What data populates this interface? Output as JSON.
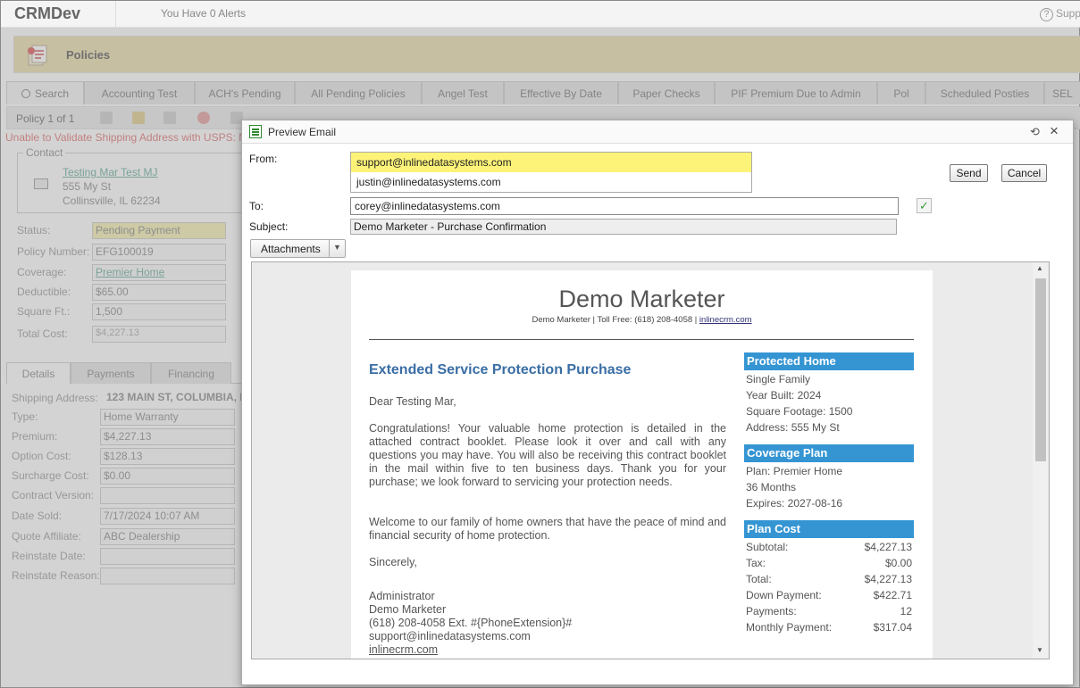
{
  "app": {
    "brand": "CRMDev",
    "alerts": "You Have 0 Alerts",
    "help": "Supp",
    "section_title": "Policies"
  },
  "tabs": [
    {
      "label": "Search"
    },
    {
      "label": "Accounting Test"
    },
    {
      "label": "ACH's Pending"
    },
    {
      "label": "All Pending Policies"
    },
    {
      "label": "Angel Test"
    },
    {
      "label": "Effective By Date"
    },
    {
      "label": "Paper Checks"
    },
    {
      "label": "PIF Premium Due to Admin"
    },
    {
      "label": "Pol"
    },
    {
      "label": "Scheduled Posties"
    },
    {
      "label": "SEL"
    }
  ],
  "toolbar": {
    "policy_count": "Policy 1 of 1"
  },
  "error_message": "Unable to Validate Shipping Address with USPS: M",
  "contact": {
    "legend": "Contact",
    "name": "Testing Mar Test MJ",
    "address1": "555 My St",
    "address2": "Collinsville, IL 62234"
  },
  "policy_fields": {
    "status_label": "Status:",
    "status": "Pending Payment",
    "number_label": "Policy Number:",
    "number": "EFG100019",
    "coverage_label": "Coverage:",
    "coverage": "Premier Home",
    "deductible_label": "Deductible:",
    "deductible": "$65.00",
    "sqft_label": "Square Ft.:",
    "sqft": "1,500",
    "total_label": "Total Cost:",
    "total": "$4,227.13"
  },
  "detail_tabs": [
    {
      "label": "Details"
    },
    {
      "label": "Payments"
    },
    {
      "label": "Financing"
    }
  ],
  "details": {
    "shipping_label": "Shipping Address:",
    "shipping": "123 MAIN ST, COLUMBIA, IL",
    "type_label": "Type:",
    "type": "Home Warranty",
    "premium_label": "Premium:",
    "premium": "$4,227.13",
    "option_label": "Option Cost:",
    "option": "$128.13",
    "surcharge_label": "Surcharge Cost:",
    "surcharge": "$0.00",
    "contract_label": "Contract Version:",
    "contract": "",
    "sold_label": "Date Sold:",
    "sold": "7/17/2024 10:07 AM",
    "affiliate_label": "Quote Affiliate:",
    "affiliate": "ABC Dealership",
    "reinstate_date_label": "Reinstate Date:",
    "reinstate_date": "",
    "reinstate_reason_label": "Reinstate Reason:",
    "reinstate_reason": ""
  },
  "modal": {
    "title": "Preview Email",
    "from_label": "From:",
    "from_options": [
      "support@inlinedatasystems.com",
      "justin@inlinedatasystems.com"
    ],
    "to_label": "To:",
    "to_value": "corey@inlinedatasystems.com",
    "subject_label": "Subject:",
    "subject_value": "Demo Marketer - Purchase Confirmation",
    "send": "Send",
    "cancel": "Cancel",
    "attachments": "Attachments"
  },
  "email": {
    "company": "Demo Marketer",
    "sub_prefix": "Demo Marketer | Toll Free: (618) 208-4058 | ",
    "sub_link": "inlinecrm.com",
    "heading": "Extended Service Protection Purchase",
    "greeting": "Dear Testing Mar,",
    "para1": "Congratulations! Your valuable home protection is detailed in the attached contract booklet. Please look it over and call with any questions you may have. You will also be receiving this contract booklet in the mail within five to ten business days. Thank you for your purchase; we look forward to servicing your protection needs.",
    "para2": "Welcome to our family of home owners that have the peace of mind and financial security of home protection.",
    "closing": "Sincerely,",
    "sig_name": "Administrator",
    "sig_company": "Demo Marketer",
    "sig_phone": "(618) 208-4058  Ext. #{PhoneExtension}#",
    "sig_email": "support@inlinedatasystems.com",
    "sig_web": "inlinecrm.com",
    "protected_home": {
      "title": "Protected Home",
      "lines": [
        "Single Family",
        "Year Built: 2024",
        "Square Footage: 1500",
        "Address: 555 My St"
      ]
    },
    "coverage_plan": {
      "title": "Coverage Plan",
      "lines": [
        "Plan: Premier Home",
        "36 Months",
        "Expires: 2027-08-16"
      ]
    },
    "plan_cost": {
      "title": "Plan Cost",
      "rows": [
        {
          "label": "Subtotal:",
          "value": "$4,227.13"
        },
        {
          "label": "Tax:",
          "value": "$0.00"
        },
        {
          "label": "Total:",
          "value": "$4,227.13"
        },
        {
          "label": "Down Payment:",
          "value": "$422.71"
        },
        {
          "label": "Payments:",
          "value": "12"
        },
        {
          "label": "Monthly Payment:",
          "value": "$317.04"
        }
      ]
    }
  }
}
